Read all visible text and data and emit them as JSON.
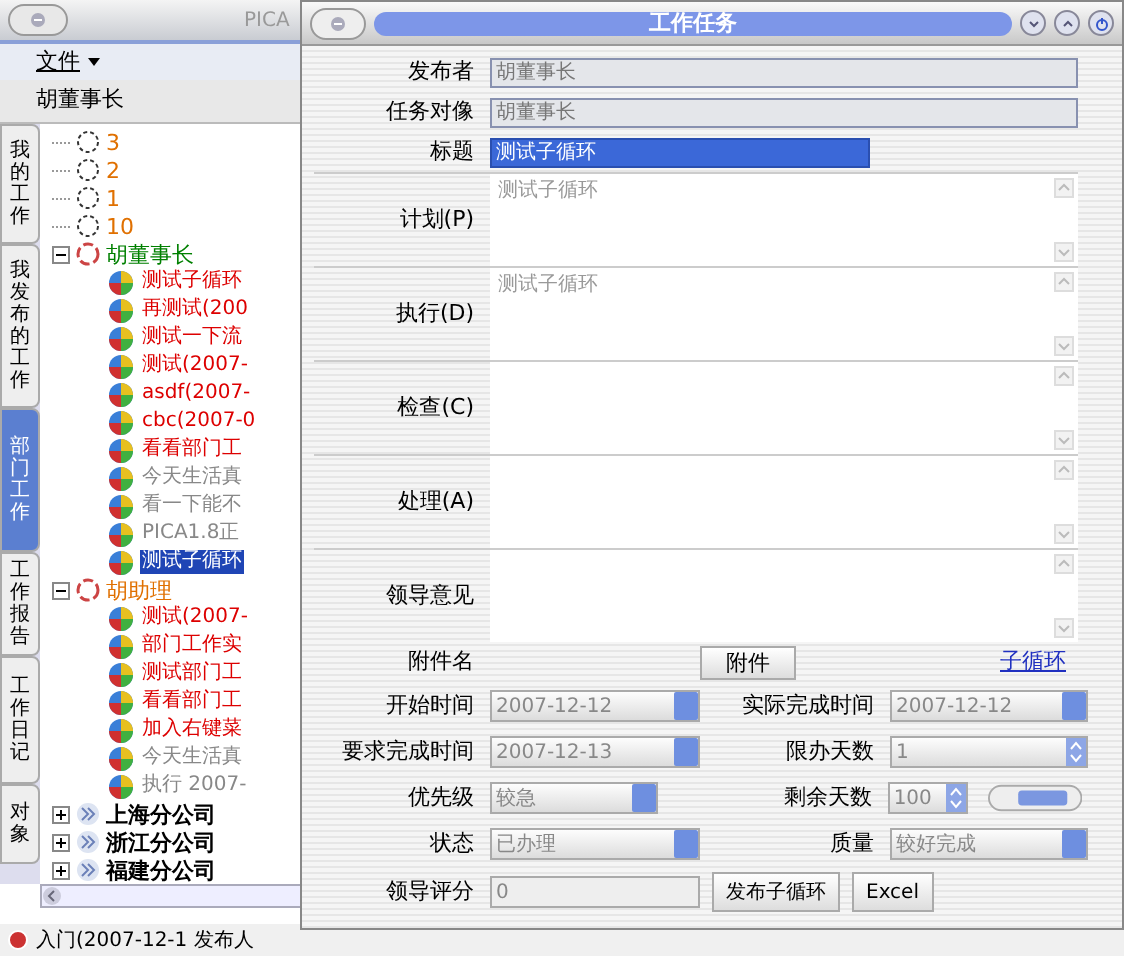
{
  "main_window": {
    "title": "PICA",
    "menu": [
      {
        "label": "文件"
      }
    ],
    "user": "胡董事长",
    "side_tabs": [
      {
        "label": "我的工作",
        "selected": false
      },
      {
        "label": "我发布的工作",
        "selected": false
      },
      {
        "label": "部门工作",
        "selected": true
      },
      {
        "label": "工作报告",
        "selected": false
      },
      {
        "label": "工作日记",
        "selected": false
      },
      {
        "label": "对象",
        "selected": false
      }
    ],
    "tree": [
      {
        "label": "3",
        "kind": "group",
        "color": "#e07000"
      },
      {
        "label": "2",
        "kind": "group",
        "color": "#e07000"
      },
      {
        "label": "1",
        "kind": "group",
        "color": "#e07000"
      },
      {
        "label": "10",
        "kind": "group",
        "color": "#e07000"
      },
      {
        "label": "胡董事长",
        "kind": "person",
        "color": "#008000",
        "expanded": true,
        "children": [
          {
            "label": "测试子循环",
            "color": "#dd0000",
            "selected": false
          },
          {
            "label": "再测试(200",
            "color": "#dd0000",
            "selected": false
          },
          {
            "label": "测试一下流",
            "color": "#dd0000",
            "selected": false
          },
          {
            "label": "测试(2007-",
            "color": "#dd0000",
            "selected": false
          },
          {
            "label": "asdf(2007-",
            "color": "#dd0000",
            "selected": false
          },
          {
            "label": "cbc(2007-0",
            "color": "#dd0000",
            "selected": false
          },
          {
            "label": "看看部门工",
            "color": "#dd0000",
            "selected": false
          },
          {
            "label": "今天生活真",
            "color": "#888888",
            "selected": false
          },
          {
            "label": "看一下能不",
            "color": "#888888",
            "selected": false
          },
          {
            "label": "PICA1.8正",
            "color": "#888888",
            "selected": false
          },
          {
            "label": "测试子循环",
            "selected": true
          }
        ]
      },
      {
        "label": "胡助理",
        "kind": "person",
        "color": "#e07000",
        "expanded": true,
        "children": [
          {
            "label": "测试(2007-",
            "color": "#dd0000",
            "selected": false
          },
          {
            "label": "部门工作实",
            "color": "#dd0000",
            "selected": false
          },
          {
            "label": "测试部门工",
            "color": "#dd0000",
            "selected": false
          },
          {
            "label": "看看部门工",
            "color": "#dd0000",
            "selected": false
          },
          {
            "label": "加入右键菜",
            "color": "#dd0000",
            "selected": false
          },
          {
            "label": "今天生活真",
            "color": "#888888",
            "selected": false
          },
          {
            "label": "执行 2007-",
            "color": "#888888",
            "selected": false
          }
        ]
      },
      {
        "label": "上海分公司",
        "kind": "branch",
        "color": "#000000",
        "expanded": false
      },
      {
        "label": "浙江分公司",
        "kind": "branch",
        "color": "#000000",
        "expanded": false
      },
      {
        "label": "福建分公司",
        "kind": "branch",
        "color": "#000000",
        "expanded": false
      }
    ],
    "status_bar": "入门(2007-12-1 发布人"
  },
  "dialog": {
    "title": "工作任务",
    "fields": [
      {
        "label": "发布者",
        "value": "胡董事长",
        "kind": "text"
      },
      {
        "label": "任务对像",
        "value": "胡董事长",
        "kind": "text"
      },
      {
        "label": "标题",
        "value": "测试子循环",
        "kind": "highlight"
      }
    ],
    "text_areas": [
      {
        "label": "计划(P)",
        "value": "测试子循环"
      },
      {
        "label": "执行(D)",
        "value": "测试子循环"
      },
      {
        "label": "检查(C)"
      },
      {
        "label": "处理(A)"
      },
      {
        "label": "领导意见"
      }
    ],
    "attachment_label": "附件名",
    "attachment_button": "附件",
    "sub_loop_link": "子循环",
    "start_time": {
      "label": "开始时间",
      "value": "2007-12-12"
    },
    "actual_finish": {
      "label": "实际完成时间",
      "value": "2007-12-12"
    },
    "due_time": {
      "label": "要求完成时间",
      "value": "2007-12-13"
    },
    "days_limit": {
      "label": "限办天数",
      "value": "1"
    },
    "priority": {
      "label": "优先级",
      "value": "较急"
    },
    "days_left": {
      "label": "剩余天数",
      "value": "100"
    },
    "status": {
      "label": "状态",
      "value": "已办理"
    },
    "quality": {
      "label": "质量",
      "value": "较好完成"
    },
    "score": {
      "label": "领导评分",
      "value": "0"
    },
    "buttons": [
      "发布子循环",
      "Excel"
    ]
  }
}
